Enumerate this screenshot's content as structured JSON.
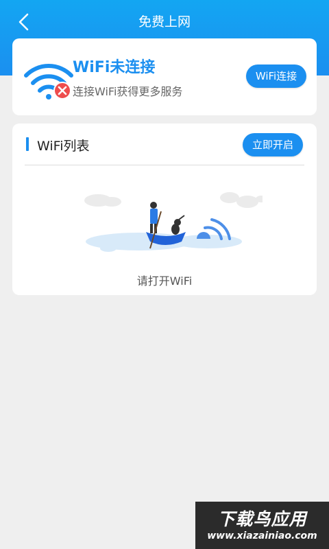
{
  "header": {
    "title": "免费上网",
    "back_icon": "chevron-left-icon",
    "gradient_top": "#13a6f2",
    "gradient_bottom": "#1b8ff0"
  },
  "status": {
    "title": "WiFi未连接",
    "subtitle": "连接WiFi获得更多服务",
    "connect_label": "WiFi连接",
    "icon": "wifi-disconnected-icon"
  },
  "wifi_list": {
    "title": "WiFi列表",
    "open_label": "立即开启",
    "empty_text": "请打开WiFi"
  },
  "watermark": {
    "brand": "下载鸟应用",
    "url": "www.xiazainiao.com"
  },
  "colors": {
    "accent": "#1b8ff0",
    "background": "#efefef",
    "error": "#ee4d4d"
  }
}
